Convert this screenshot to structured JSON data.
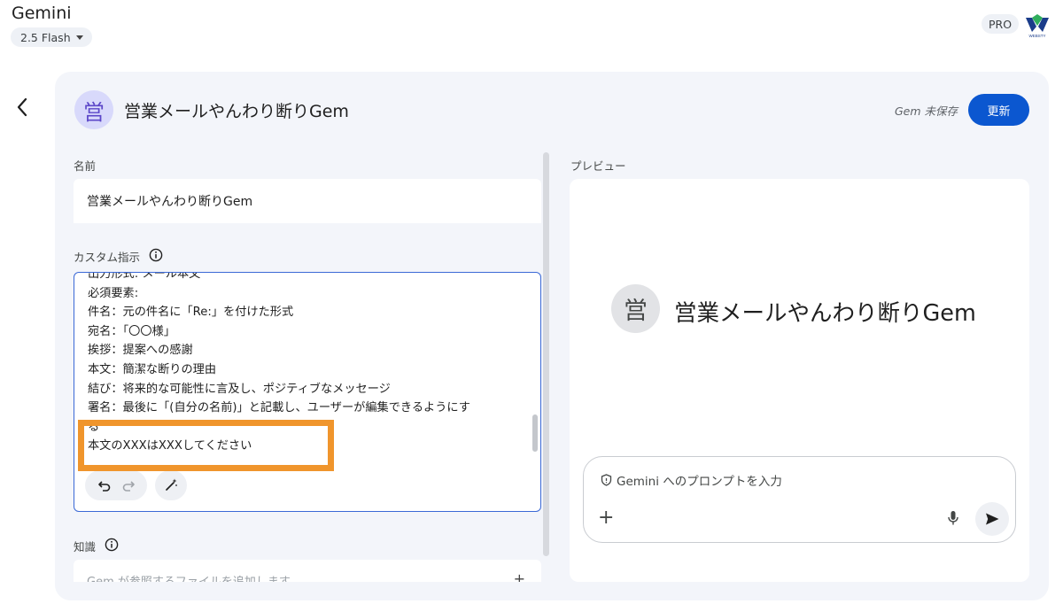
{
  "app": {
    "title": "Gemini",
    "model": "2.5 Flash",
    "badge": "PRO",
    "logo_text": "WEBSTY"
  },
  "header": {
    "avatar_char": "営",
    "gem_name": "営業メールやんわり断りGem",
    "status": "Gem 未保存",
    "update_label": "更新"
  },
  "form": {
    "name_label": "名前",
    "name_value": "営業メールやんわり断りGem",
    "instructions_label": "カスタム指示",
    "instruction_lines": [
      "出力形式: メール本文",
      "必須要素:",
      "件名：元の件名に「Re:」を付けた形式",
      "宛名：「〇〇様」",
      "挨拶：提案への感謝",
      "本文：簡潔な断りの理由",
      "結び：将来的な可能性に言及し、ポジティブなメッセージ",
      "署名：最後に「(自分の名前)」と記載し、ユーザーが編集できるようにす",
      "る",
      "本文のXXXはXXXしてください"
    ],
    "knowledge_label": "知識",
    "knowledge_placeholder": "Gem が参照するファイルを追加します"
  },
  "preview": {
    "label": "プレビュー",
    "avatar_char": "営",
    "gem_name": "営業メールやんわり断りGem",
    "prompt_placeholder": "Gemini へのプロンプトを入力"
  },
  "colors": {
    "accent": "#0b57d0",
    "highlight": "#f0952c",
    "avatar_bg": "#d8d9fb"
  },
  "icons": [
    "chevron-down-icon",
    "back-arrow-icon",
    "info-icon",
    "undo-icon",
    "redo-icon",
    "magic-wand-icon",
    "plus-icon",
    "shield-icon",
    "mic-icon",
    "send-icon"
  ]
}
